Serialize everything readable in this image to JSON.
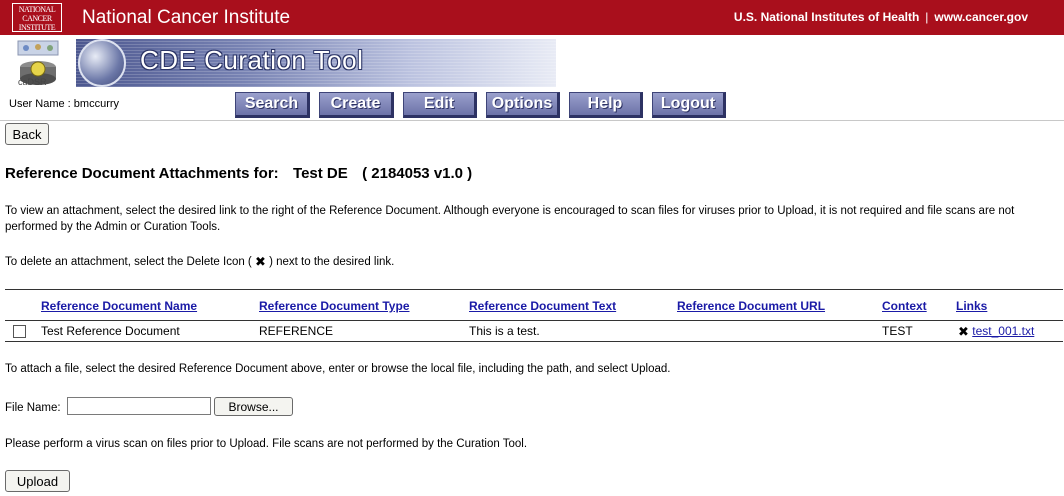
{
  "banner": {
    "logo_lines": [
      "NATIONAL",
      "CANCER",
      "INSTITUTE"
    ],
    "title": "National Cancer Institute",
    "link_nih": "U.S. National Institutes of Health",
    "separator": "|",
    "link_cancer": "www.cancer.gov"
  },
  "header": {
    "app_title": "CDE Curation Tool",
    "cadsr_label": "caDSR",
    "user_name": "User Name : bmccurry",
    "nav": [
      "Search",
      "Create",
      "Edit",
      "Options",
      "Help",
      "Logout"
    ]
  },
  "back_label": "Back",
  "heading": {
    "prefix": "Reference Document Attachments for:",
    "name": "Test DE",
    "id": "( 2184053 v1.0 )"
  },
  "instructions": {
    "view": "To view an attachment, select the desired link to the right of the Reference Document. Although everyone is encouraged to scan files for viruses prior to Upload, it is not required and file scans are not performed by the Admin or Curation Tools.",
    "delete_before": "To delete an attachment, select the Delete Icon (",
    "delete_after": ") next to the desired link.",
    "attach": "To attach a file, select the desired Reference Document above, enter or browse the local file, including the path, and select Upload.",
    "scan": "Please perform a virus scan on files prior to Upload. File scans are not performed by the Curation Tool."
  },
  "table": {
    "headers": [
      "Reference Document Name",
      "Reference Document Type",
      "Reference Document Text",
      "Reference Document URL",
      "Context",
      "Links"
    ],
    "rows": [
      {
        "name": "Test Reference Document",
        "type": "REFERENCE",
        "text": "This is a test.",
        "url": "",
        "context": "TEST",
        "link": "test_001.txt"
      }
    ]
  },
  "file": {
    "label": "File Name:",
    "value": "",
    "browse_label": "Browse..."
  },
  "upload_label": "Upload",
  "icons": {
    "delete": "delete-icon",
    "colors": {
      "banner": "#a90f1c",
      "nav": "#6c72a8",
      "link": "#1a1aa6"
    }
  }
}
